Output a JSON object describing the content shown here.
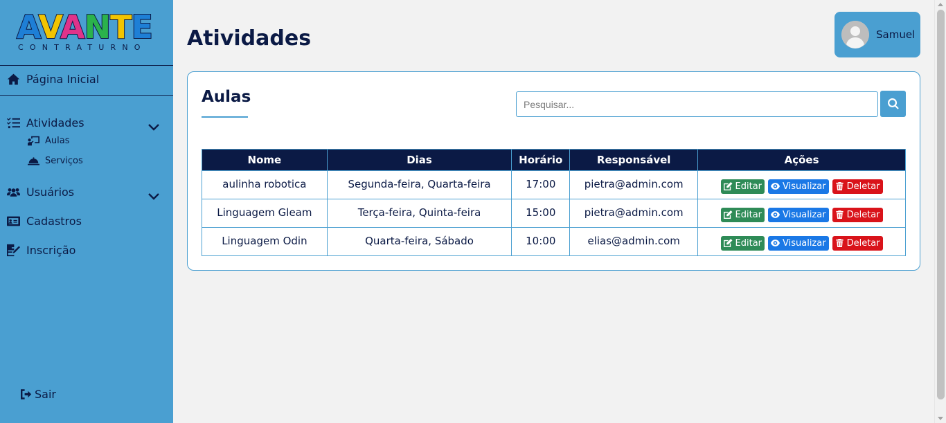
{
  "logo": {
    "word": "AVANTE",
    "letters": [
      "A",
      "V",
      "A",
      "N",
      "T",
      "E"
    ],
    "letter_colors": [
      "#1e7fd6",
      "#f2c400",
      "#e0338a",
      "#2bb24c",
      "#f2c400",
      "#1e7fd6"
    ],
    "subtitle": "CONTRATURNO"
  },
  "sidebar": {
    "home": {
      "label": "Página Inicial",
      "icon": "home-icon"
    },
    "atividades": {
      "label": "Atividades",
      "icon": "list-icon"
    },
    "aulas": {
      "label": "Aulas",
      "icon": "chalkboard-icon"
    },
    "servicos": {
      "label": "Serviços",
      "icon": "service-bell-icon"
    },
    "usuarios": {
      "label": "Usuários",
      "icon": "users-icon"
    },
    "cadastros": {
      "label": "Cadastros",
      "icon": "id-card-icon"
    },
    "inscricao": {
      "label": "Inscrição",
      "icon": "signature-icon"
    },
    "sair": {
      "label": "Sair",
      "icon": "sign-out-icon"
    }
  },
  "header": {
    "title": "Atividades",
    "user_name": "Samuel"
  },
  "card": {
    "title": "Aulas",
    "search_placeholder": "Pesquisar...",
    "columns": [
      "Nome",
      "Dias",
      "Horário",
      "Responsável",
      "Ações"
    ],
    "rows": [
      {
        "nome": "aulinha robotica",
        "dias": "Segunda-feira, Quarta-feira",
        "horario": "17:00",
        "responsavel": "pietra@admin.com"
      },
      {
        "nome": "Linguagem Gleam",
        "dias": "Terça-feira, Quinta-feira",
        "horario": "15:00",
        "responsavel": "pietra@admin.com"
      },
      {
        "nome": "Linguagem Odin",
        "dias": "Quarta-feira, Sábado",
        "horario": "10:00",
        "responsavel": "elias@admin.com"
      }
    ],
    "actions": {
      "edit": "Editar",
      "view": "Visualizar",
      "delete": "Deletar"
    }
  },
  "colors": {
    "sidebar": "#4a9fd1",
    "navy": "#0b1a45",
    "edit": "#2e8b57",
    "view": "#1a78e6",
    "delete": "#d9131a"
  }
}
